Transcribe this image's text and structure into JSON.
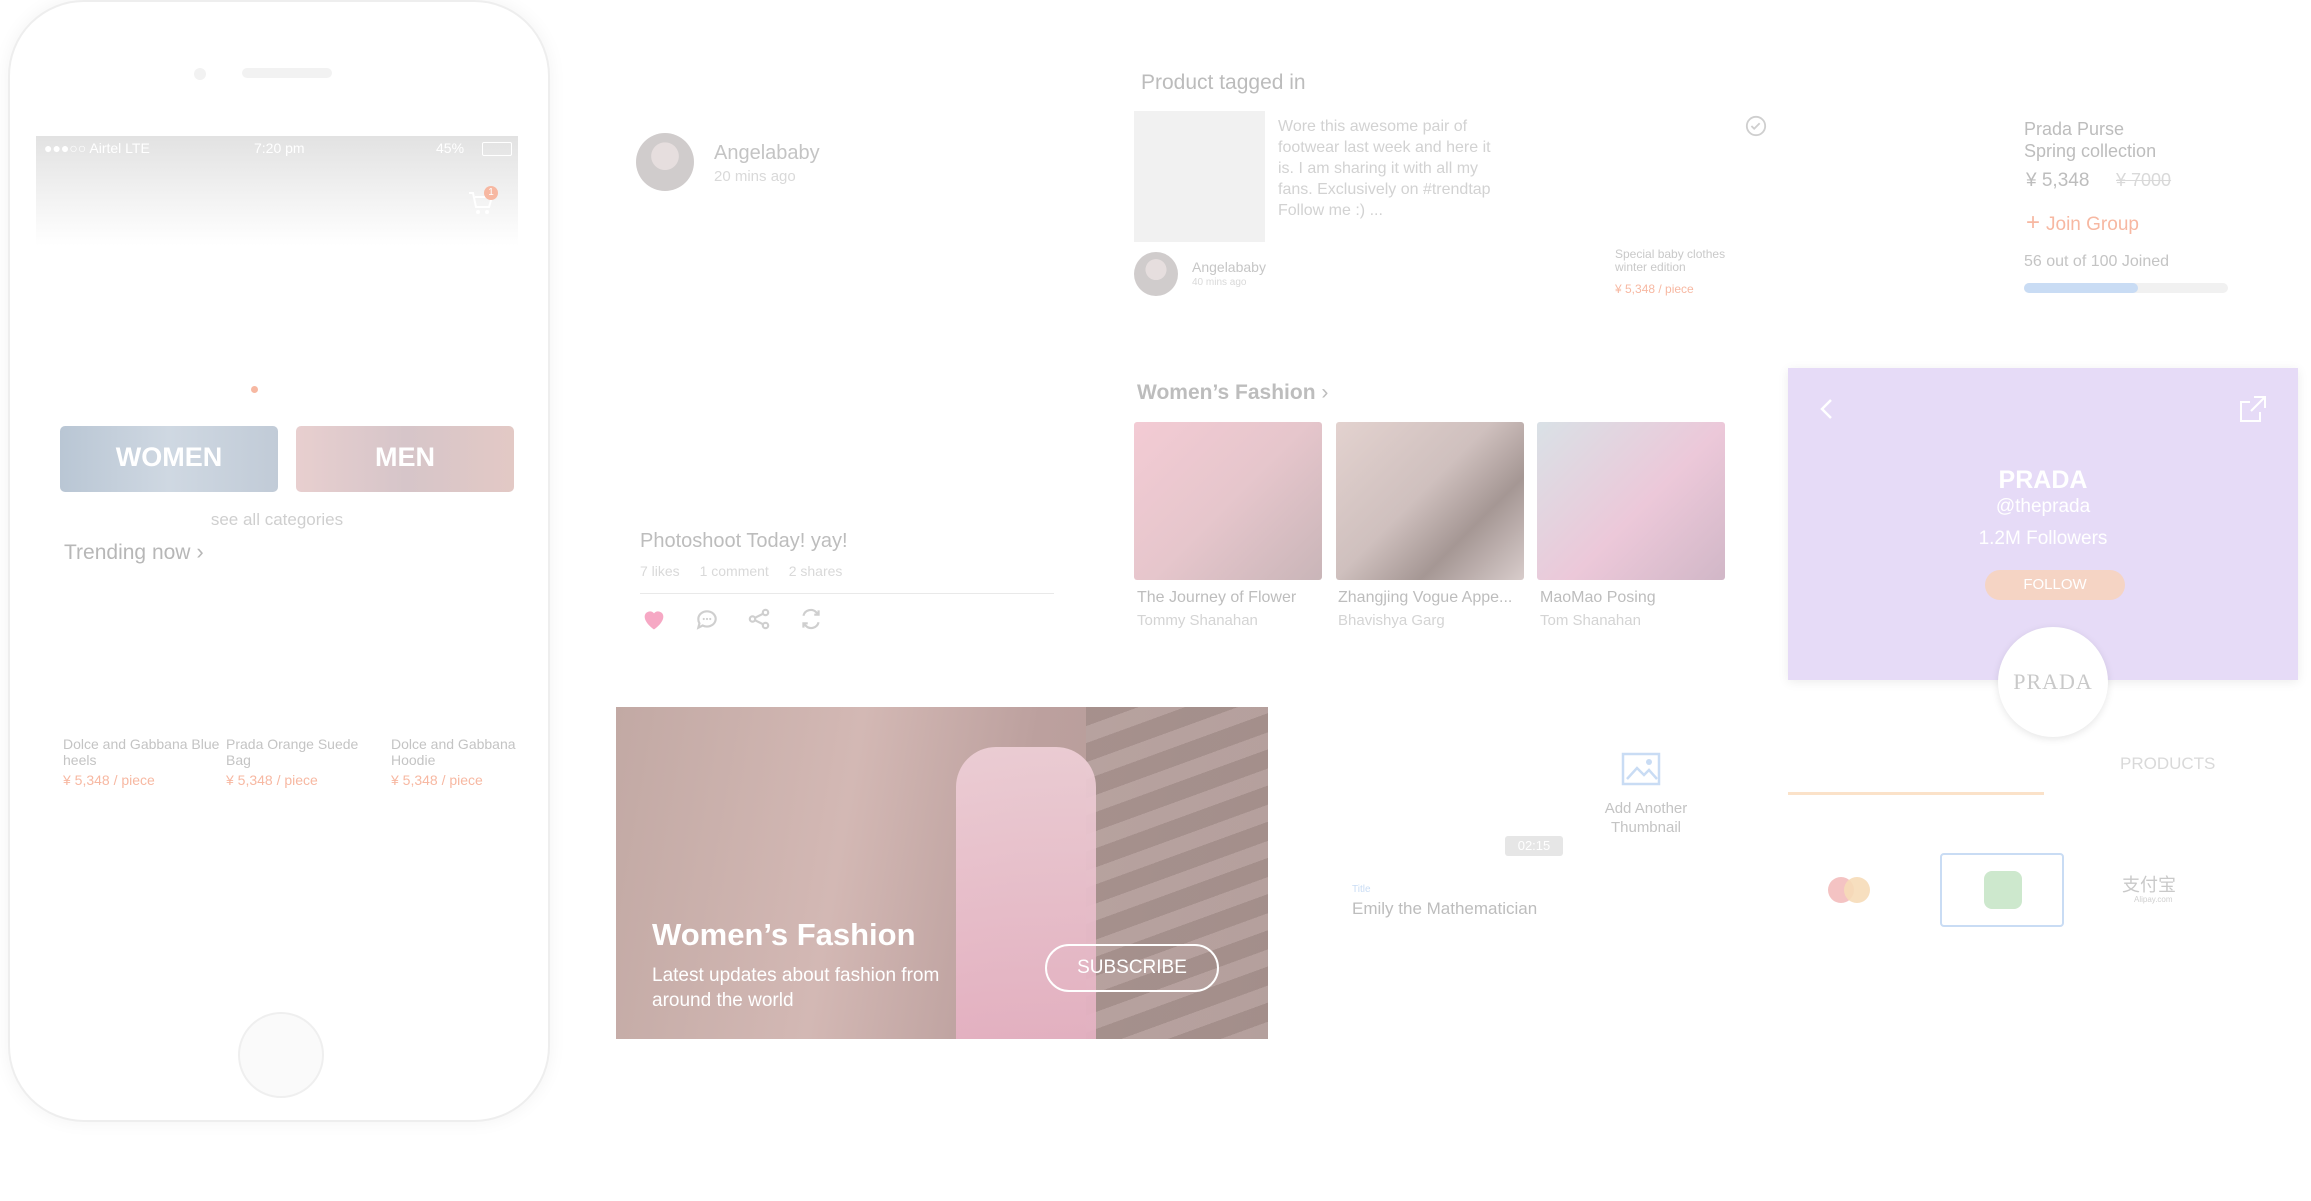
{
  "phone": {
    "status": {
      "carrier": "●●●○○ Airtel  LTE",
      "time": "7:20 pm",
      "battery": "45%"
    },
    "cart_badge": "1",
    "categories": [
      {
        "label": "WOMEN"
      },
      {
        "label": "MEN"
      }
    ],
    "see_all": "see all categories",
    "trending_title": "Trending now",
    "trending": [
      {
        "name": "Dolce and Gabbana Blue heels",
        "price": "¥ 5,348 / piece"
      },
      {
        "name": "Prada Orange Suede Bag",
        "price": "¥ 5,348 / piece"
      },
      {
        "name": "Dolce and Gabbana Hoodie",
        "price": "¥ 5,348 / piece"
      }
    ]
  },
  "post": {
    "author": "Angelababy",
    "time": "20 mins ago",
    "caption": "Photoshoot Today! yay!",
    "likes": "7 likes",
    "comments": "1 comment",
    "shares": "2 shares"
  },
  "tagged": {
    "title": "Product tagged in",
    "text": "Wore this awesome pair of footwear last week and here it is. I am sharing it with all my fans. Exclusively on #trendtap Follow me :) ...",
    "author": "Angelababy",
    "time": "40 mins ago",
    "product_name": "Special baby clothes winter edition",
    "product_price": "¥ 5,348 / piece"
  },
  "group_buy": {
    "title": "Prada Purse",
    "subtitle": "Spring collection",
    "price": "¥ 5,348",
    "old_price": "¥ 7000",
    "join_label": "Join Group",
    "joined_text": "56 out of 100 Joined",
    "joined_fraction": 0.56
  },
  "womens_fashion": {
    "title": "Women’s Fashion",
    "cards": [
      {
        "title": "The Journey of Flower",
        "author": "Tommy Shanahan"
      },
      {
        "title": "Zhangjing Vogue Appe...",
        "author": "Bhavishya Garg"
      },
      {
        "title": "MaoMao Posing",
        "author": "Tom Shanahan"
      }
    ]
  },
  "banner": {
    "title": "Women’s Fashion",
    "subtitle": "Latest updates about fashion from around the world",
    "subscribe": "SUBSCRIBE"
  },
  "video": {
    "add_thumbnail": "Add Another Thumbnail",
    "duration": "02:15",
    "title_label": "Title",
    "title_value": "Emily the Mathematician"
  },
  "profile": {
    "brand": "PRADA",
    "handle": "@theprada",
    "followers": "1.2M Followers",
    "follow": "FOLLOW",
    "logo_text": "PRADA",
    "products_tab": "PRODUCTS"
  },
  "payment": {
    "options": [
      {
        "label": "mastercard"
      },
      {
        "label": "wechat"
      },
      {
        "label": "支付宝",
        "sub": "Alipay.com"
      }
    ]
  },
  "colors": {
    "accent": "#f7b8a2",
    "profile_bg": "#e6dbf7",
    "progress": "#c9dcf4",
    "wechat": "#cde8cd"
  }
}
